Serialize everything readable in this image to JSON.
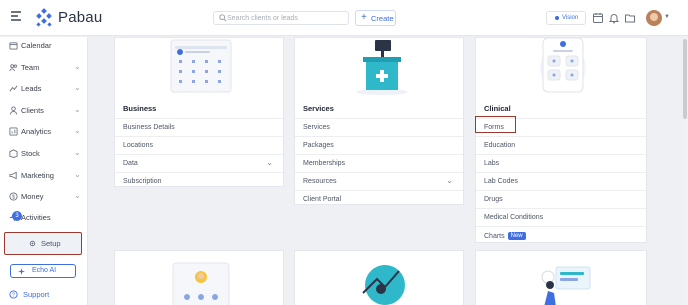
{
  "app": {
    "name": "Pabau"
  },
  "header": {
    "search_placeholder": "Search clients or leads",
    "create_label": "Create",
    "vision_label": "Vision"
  },
  "sidebar": {
    "items": [
      {
        "label": "Calendar",
        "icon": "calendar-icon"
      },
      {
        "label": "Team",
        "icon": "team-icon"
      },
      {
        "label": "Leads",
        "icon": "leads-icon"
      },
      {
        "label": "Clients",
        "icon": "clients-icon"
      },
      {
        "label": "Analytics",
        "icon": "analytics-icon"
      },
      {
        "label": "Stock",
        "icon": "stock-icon"
      },
      {
        "label": "Marketing",
        "icon": "marketing-icon"
      },
      {
        "label": "Money",
        "icon": "money-icon"
      },
      {
        "label": "Activities",
        "icon": "activities-icon"
      }
    ],
    "setup_label": "Setup",
    "echo_label": "Echo AI",
    "support_label": "Support",
    "activities_badge": "3"
  },
  "cards": {
    "business": {
      "title": "Business",
      "rows": [
        "Business Details",
        "Locations",
        "Data",
        "Subscription"
      ]
    },
    "services": {
      "title": "Services",
      "rows": [
        "Services",
        "Packages",
        "Memberships",
        "Resources",
        "Client Portal"
      ]
    },
    "clinical": {
      "title": "Clinical",
      "rows": [
        "Forms",
        "Education",
        "Labs",
        "Lab Codes",
        "Drugs",
        "Medical Conditions",
        "Charts"
      ],
      "charts_badge": "New"
    }
  },
  "colors": {
    "accent": "#3f6ee0",
    "highlight_box": "#9a3a2e",
    "teal": "#2eb8c9"
  }
}
